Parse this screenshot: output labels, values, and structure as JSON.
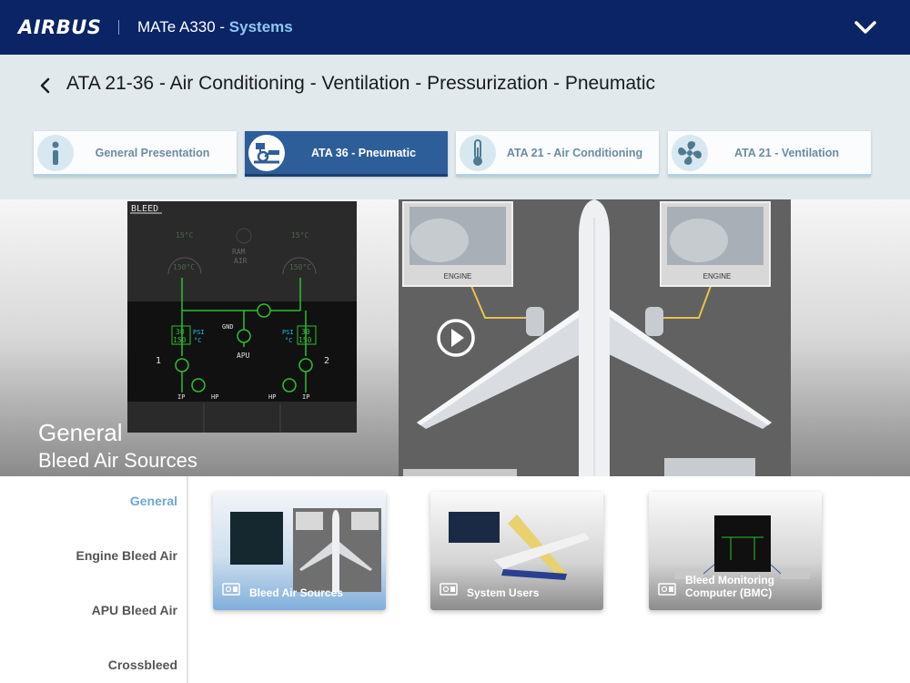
{
  "topbar": {
    "logo": "AIRBUS",
    "app_prefix": "MATe A330 - ",
    "app_section": "Systems",
    "menu_icon": "chevron-down-icon"
  },
  "header": {
    "title": "ATA 21-36 - Air Conditioning - Ventilation - Pressurization - Pneumatic",
    "back_icon": "chevron-left-icon"
  },
  "tabs": [
    {
      "label": "General Presentation",
      "icon": "info-icon",
      "active": false
    },
    {
      "label": "ATA 36 - Pneumatic",
      "icon": "pneumatic-valve-icon",
      "active": true
    },
    {
      "label": "ATA 21 - Air Conditioning",
      "icon": "thermometer-icon",
      "active": false
    },
    {
      "label": "ATA 21 - Ventilation",
      "icon": "fan-icon",
      "active": false
    }
  ],
  "hero": {
    "title": "General",
    "subtitle": "Bleed Air Sources",
    "play_icon": "play-icon",
    "ecam": {
      "page_label": "BLEED",
      "ram_air": "RAM",
      "ram_air2": "AIR",
      "temp1": "15°C",
      "temp2": "150°C",
      "gnd": "GND",
      "apu": "APU",
      "psi_label": "PSI",
      "c_label": "°C",
      "psi_value": "30",
      "c_value": "150",
      "engine1": "1",
      "engine2": "2",
      "ip": "IP",
      "hp": "HP"
    },
    "plane": {
      "engine_label_left": "ENGINE",
      "engine_label_right": "ENGINE"
    }
  },
  "sidenav": {
    "items": [
      {
        "label": "General",
        "active": true
      },
      {
        "label": "Engine Bleed Air",
        "active": false
      },
      {
        "label": "APU Bleed Air",
        "active": false
      },
      {
        "label": "Crossbleed",
        "active": false
      }
    ]
  },
  "cards": [
    {
      "caption": "Bleed Air Sources",
      "icon": "gallery-icon"
    },
    {
      "caption": "System Users",
      "icon": "gallery-icon"
    },
    {
      "caption": "Bleed Monitoring Computer (BMC)",
      "icon": "gallery-icon"
    }
  ],
  "colors": {
    "topbar": "#0a2466",
    "accent": "#8fc8f0",
    "active_tab": "#2e5e9a",
    "active_nav": "#6fa7d6",
    "header_bg": "#e1e9ed"
  }
}
